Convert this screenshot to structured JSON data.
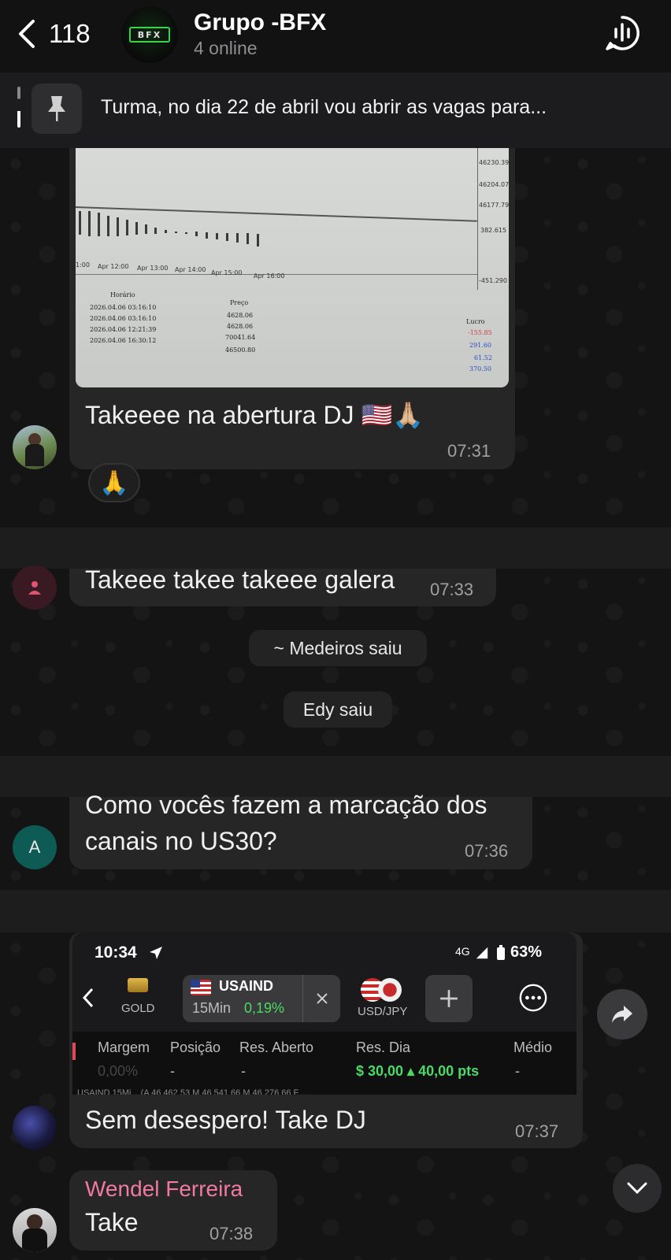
{
  "header": {
    "back_count": "118",
    "group_name": "Grupo -BFX",
    "group_logo_text": "BFX",
    "status": "4 online"
  },
  "pinned": {
    "text": "Turma, no dia 22 de abril vou abrir as vagas para..."
  },
  "messages": [
    {
      "text": "Takeeee na abertura DJ 🇺🇸🙏🏼",
      "time": "07:31",
      "reaction": "🙏",
      "chart_screenshot": {
        "price_ticks": [
          "46230.39",
          "46204.07",
          "46177.79",
          "382.615",
          "-451.290"
        ],
        "time_ticks": [
          "1:00",
          "Apr 12:00",
          "Apr 13:00",
          "Apr 14:00",
          "Apr 15:00",
          "Apr 16:00"
        ],
        "col_horario": "Horário",
        "col_preco": "Preço",
        "col_lucro": "Lucro",
        "rows": [
          {
            "horario": "2026.04.06 03:16:10",
            "preco": "4628.06",
            "lucro": "-155.85"
          },
          {
            "horario": "2026.04.06 03:16:10",
            "preco": "4628.06",
            "lucro": "291.60"
          },
          {
            "horario": "2026.04.06 12:21:39",
            "preco": "70041.64",
            "lucro": "61.52"
          },
          {
            "horario": "2026.04.06 16:30:12",
            "preco": "46500.80",
            "lucro": "370.50"
          }
        ]
      }
    },
    {
      "text": "Takeee takee takeee galera",
      "time": "07:33"
    },
    {
      "text_line1": "Como vocês fazem a marcação dos",
      "text_line2": "canais no US30?",
      "time": "07:36",
      "avatar_letter": "A"
    },
    {
      "text": "Sem desespero! Take DJ",
      "time": "07:37",
      "trade_screenshot": {
        "clock": "10:34",
        "network": "4G",
        "battery": "63%",
        "gold": "GOLD",
        "symbol": "USAIND",
        "timeframe": "15Min",
        "change": "0,19%",
        "pair": "USD/JPY",
        "labels": [
          "Margem",
          "Posição",
          "Res. Aberto",
          "Res. Dia",
          "Médio"
        ],
        "values": [
          "0,00%",
          "-",
          "-",
          "$ 30,00 ▴ 40,00 pts",
          "-"
        ],
        "bottom_line": "USAIND 15Mi... (A 46 462 53 M 46 541 66 M 46 276 66 F ..."
      }
    },
    {
      "sender": "Wendel Ferreira",
      "text": "Take",
      "time": "07:38"
    }
  ],
  "system": {
    "left1": "~ Medeiros saiu",
    "left2": "Edy saiu"
  },
  "colors": {
    "background": "#121212",
    "bubble": "#262626",
    "sender": "#f07aa0",
    "positive": "#4cd964",
    "negative": "#e0495b"
  }
}
